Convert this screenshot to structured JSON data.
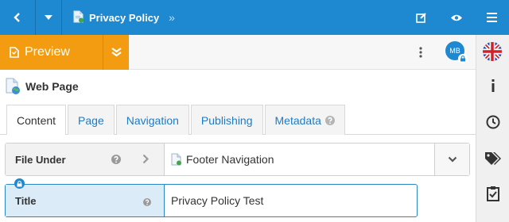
{
  "topbar": {
    "breadcrumb_title": "Privacy Policy",
    "breadcrumb_more": "»",
    "icons": [
      "back-icon",
      "caret-down-icon",
      "page-icon",
      "edit-icon",
      "eye-icon",
      "menu-icon"
    ],
    "background": "#1e88d0"
  },
  "toolbar": {
    "preview_label": "Preview",
    "preview_color": "#f39c12",
    "avatar_initials": "MB"
  },
  "content": {
    "heading": "Web Page",
    "tabs": [
      {
        "label": "Content",
        "active": true
      },
      {
        "label": "Page",
        "active": false
      },
      {
        "label": "Navigation",
        "active": false
      },
      {
        "label": "Publishing",
        "active": false
      },
      {
        "label": "Metadata",
        "active": false,
        "help_icon": true
      }
    ],
    "fields": {
      "file_under": {
        "label": "File Under",
        "value": "Footer Navigation"
      },
      "title": {
        "label": "Title",
        "value": "Privacy Policy Test"
      }
    }
  },
  "rail": {
    "icons": [
      "flag-uk-icon",
      "info-icon",
      "clock-icon",
      "tags-icon",
      "checklist-icon"
    ]
  }
}
